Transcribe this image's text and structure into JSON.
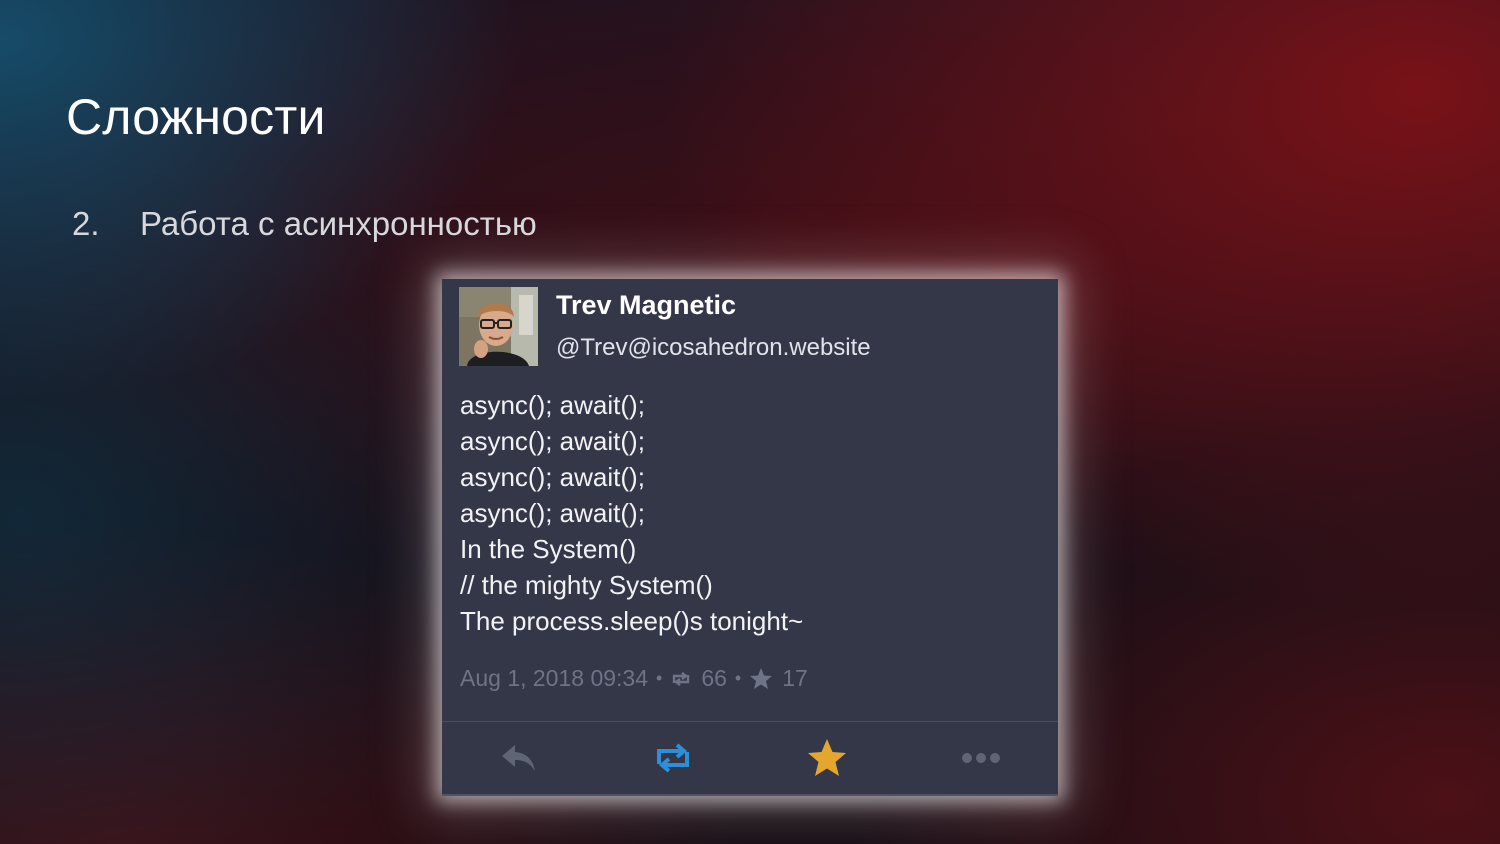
{
  "slide": {
    "title": "Сложности",
    "bullet": {
      "number": "2.",
      "text": "Работа с асинхронностью"
    }
  },
  "tweet": {
    "display_name": "Trev Magnetic",
    "handle": "@Trev@icosahedron.website",
    "lines": [
      "async(); await();",
      "async(); await();",
      "async(); await();",
      "async(); await();",
      "In the System()",
      "// the mighty System()",
      "The process.sleep()s tonight~"
    ],
    "timestamp": "Aug 1, 2018 09:34",
    "separator": "•",
    "boost_count": "66",
    "favourite_count": "17",
    "actions": [
      "reply-icon",
      "boost-icon",
      "favourite-icon",
      "more-icon"
    ]
  },
  "colors": {
    "card_background": "#343748",
    "meta_text": "#6e7387",
    "boost_blue": "#2b90d9",
    "favourite_gold": "#e4a62f",
    "action_grey": "#5f6477"
  }
}
